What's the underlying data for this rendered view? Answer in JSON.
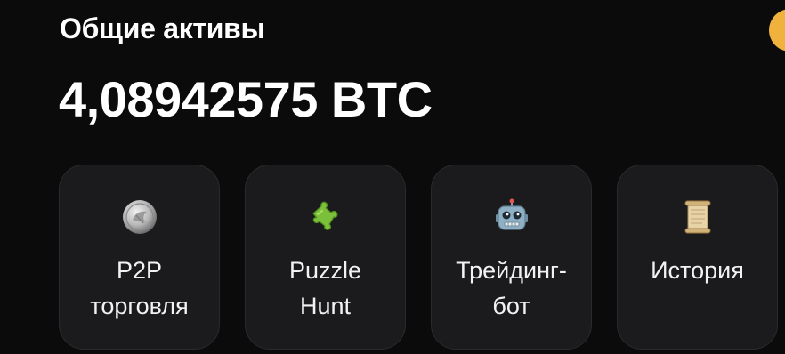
{
  "header": {
    "title": "Общие активы",
    "total_balance": "4,08942575 BTC"
  },
  "colors": {
    "background": "#0b0b0c",
    "tile_background": "#1b1b1d",
    "avatar_accent": "#f0b23c"
  },
  "tiles": [
    {
      "label": "P2P\nторговля",
      "icon": "coin-icon"
    },
    {
      "label": "Puzzle\nHunt",
      "icon": "puzzle-icon"
    },
    {
      "label": "Трейдинг-\nбот",
      "icon": "robot-icon"
    },
    {
      "label": "История",
      "icon": "scroll-icon"
    }
  ]
}
